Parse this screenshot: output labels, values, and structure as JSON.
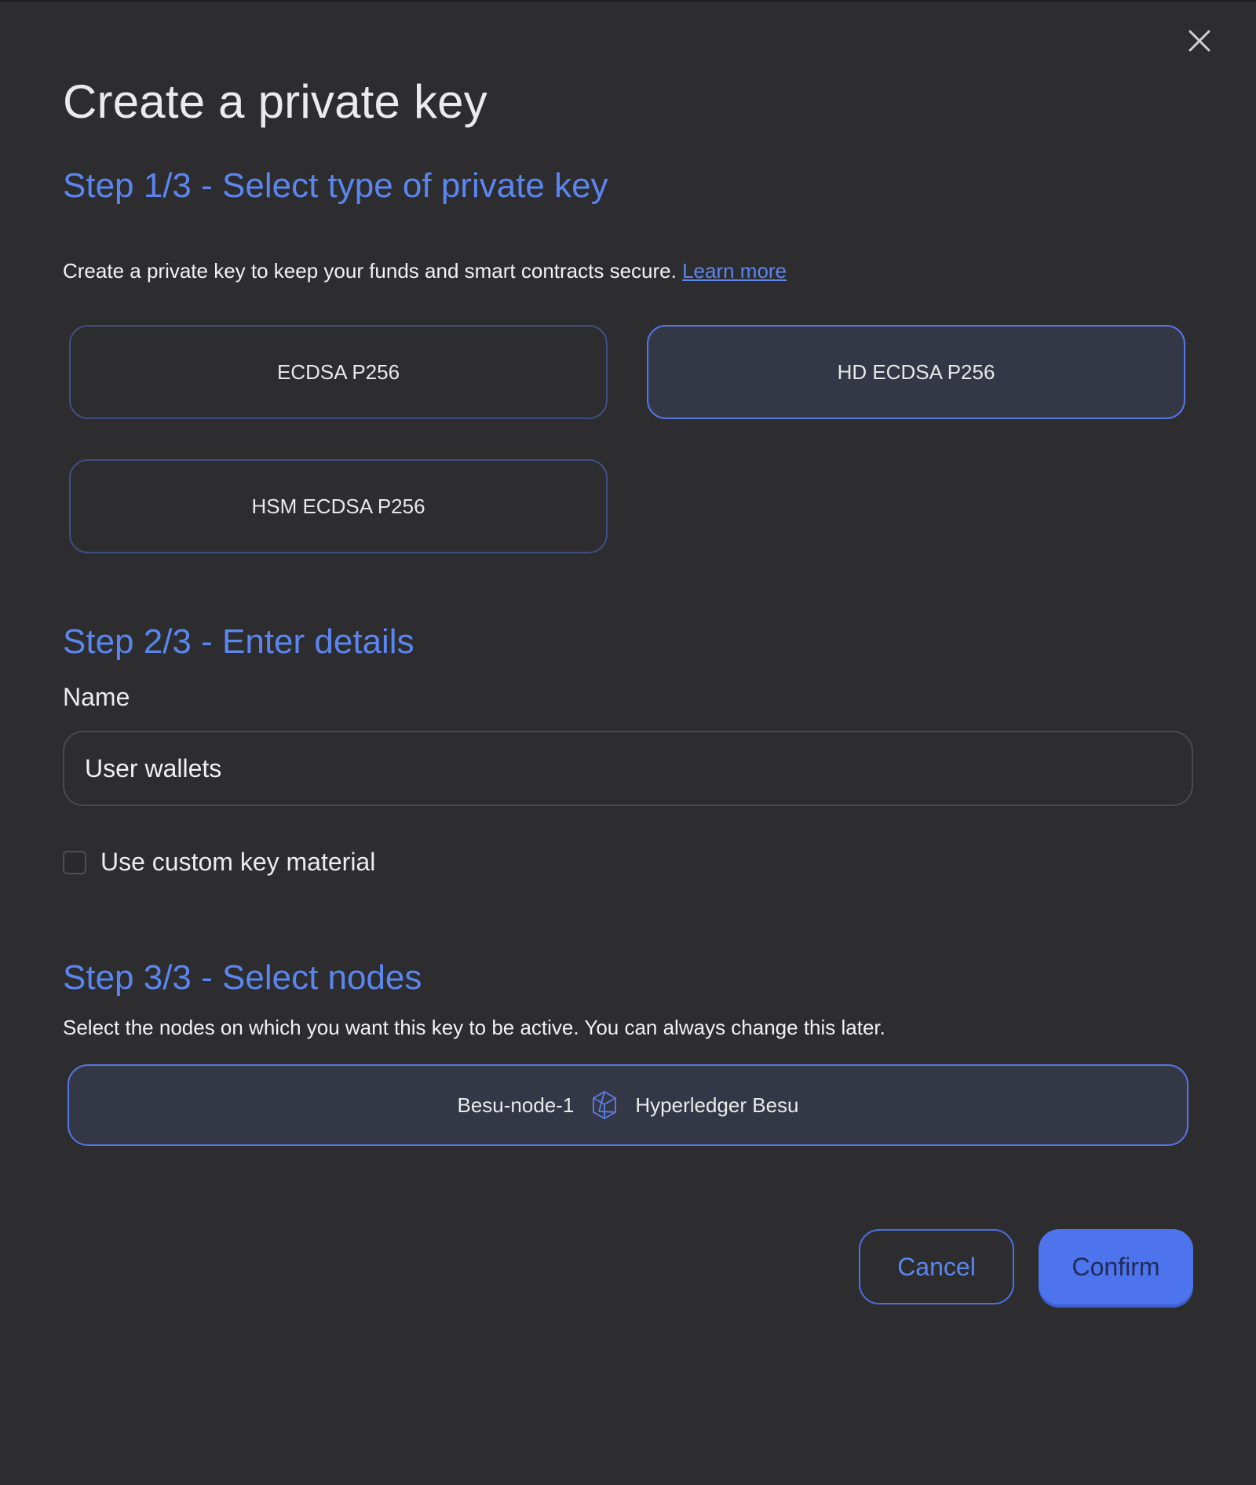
{
  "dialog": {
    "title": "Create a private key",
    "close_icon": "close-icon"
  },
  "step1": {
    "heading": "Step 1/3 - Select type of private key",
    "description": "Create a private key to keep your funds and smart contracts secure.",
    "learn_more": "Learn more",
    "options": [
      {
        "label": "ECDSA P256",
        "selected": false
      },
      {
        "label": "HD ECDSA P256",
        "selected": true
      },
      {
        "label": "HSM ECDSA P256",
        "selected": false
      }
    ]
  },
  "step2": {
    "heading": "Step 2/3 - Enter details",
    "name_label": "Name",
    "name_value": "User wallets",
    "custom_key_label": "Use custom key material",
    "custom_key_checked": false
  },
  "step3": {
    "heading": "Step 3/3 - Select nodes",
    "description": "Select the nodes on which you want this key to be active. You can always change this later.",
    "nodes": [
      {
        "name": "Besu-node-1",
        "icon": "hyperledger-besu-icon",
        "type": "Hyperledger Besu",
        "selected": true
      }
    ]
  },
  "actions": {
    "cancel": "Cancel",
    "confirm": "Confirm"
  },
  "colors": {
    "background": "#2d2d2f",
    "accent": "#5b86f0",
    "selected_border": "#5577e6",
    "selected_fill": "#343746",
    "confirm_fill": "#4d74ec"
  }
}
